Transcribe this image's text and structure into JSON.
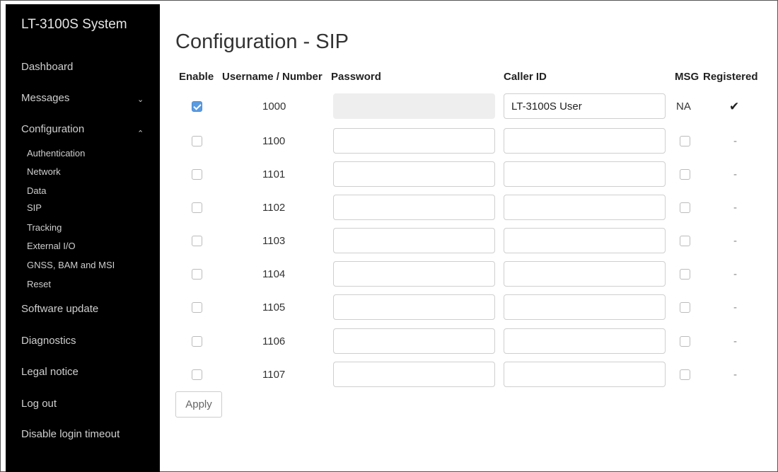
{
  "sidebar": {
    "brand": "LT-3100S System",
    "items": {
      "dashboard": "Dashboard",
      "messages": "Messages",
      "configuration": "Configuration",
      "software_update": "Software update",
      "diagnostics": "Diagnostics",
      "legal_notice": "Legal notice",
      "log_out": "Log out",
      "disable_login_timeout": "Disable login timeout"
    },
    "messages_chevron": "⌄",
    "configuration_chevron": "⌃",
    "sub_items": [
      "Authentication",
      "Network",
      "Data",
      "SIP",
      "Tracking",
      "External I/O",
      "GNSS, BAM and MSI",
      "Reset"
    ]
  },
  "page": {
    "title": "Configuration - SIP"
  },
  "table": {
    "headers": {
      "enable": "Enable",
      "username": "Username / Number",
      "password": "Password",
      "caller_id": "Caller ID",
      "msg": "MSG",
      "registered": "Registered"
    },
    "rows": [
      {
        "enabled": true,
        "number": "1000",
        "password": "",
        "caller_id": "LT-3100S User",
        "msg": "NA",
        "registered": "✔"
      },
      {
        "enabled": false,
        "number": "1100",
        "password": "",
        "caller_id": "",
        "msg": "",
        "registered": "-"
      },
      {
        "enabled": false,
        "number": "1101",
        "password": "",
        "caller_id": "",
        "msg": "",
        "registered": "-"
      },
      {
        "enabled": false,
        "number": "1102",
        "password": "",
        "caller_id": "",
        "msg": "",
        "registered": "-"
      },
      {
        "enabled": false,
        "number": "1103",
        "password": "",
        "caller_id": "",
        "msg": "",
        "registered": "-"
      },
      {
        "enabled": false,
        "number": "1104",
        "password": "",
        "caller_id": "",
        "msg": "",
        "registered": "-"
      },
      {
        "enabled": false,
        "number": "1105",
        "password": "",
        "caller_id": "",
        "msg": "",
        "registered": "-"
      },
      {
        "enabled": false,
        "number": "1106",
        "password": "",
        "caller_id": "",
        "msg": "",
        "registered": "-"
      },
      {
        "enabled": false,
        "number": "1107",
        "password": "",
        "caller_id": "",
        "msg": "",
        "registered": "-"
      }
    ]
  },
  "actions": {
    "apply_label": "Apply"
  },
  "colors": {
    "sidebar_bg": "#000000",
    "checkbox_checked": "#5b9be0"
  }
}
